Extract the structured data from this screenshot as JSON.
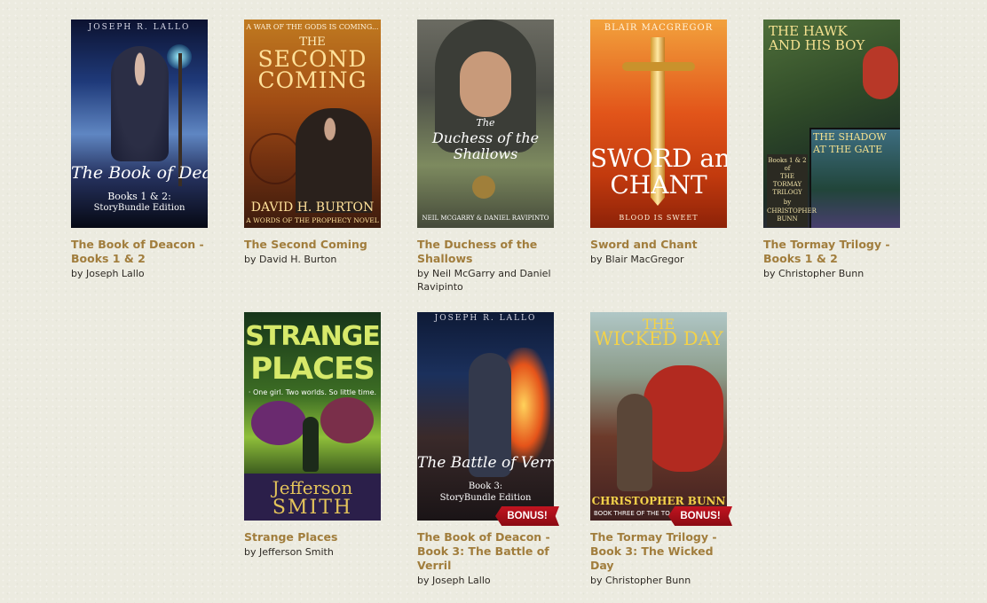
{
  "books": [
    {
      "title": "The Book of Deacon - Books 1 & 2",
      "author": "by Joseph Lallo",
      "cover": {
        "author": "JOSEPH R. LALLO",
        "title": "The Book of Deacon",
        "subtitle1": "Books 1 & 2:",
        "subtitle2": "StoryBundle Edition"
      }
    },
    {
      "title": "The Second Coming",
      "author": "by David H. Burton",
      "cover": {
        "tagline": "A WAR OF THE GODS IS COMING...",
        "title1": "THE",
        "title2": "SECOND",
        "title3": "COMING",
        "author": "DAVID H. BURTON",
        "subtitle": "A WORDS OF THE PROPHECY NOVEL"
      }
    },
    {
      "title": "The Duchess of the Shallows",
      "author": "by Neil McGarry and Daniel Ravipinto",
      "cover": {
        "title1": "The",
        "title2": "Duchess of the",
        "title3": "Shallows",
        "author": "NEIL MCGARRY & DANIEL RAVIPINTO"
      }
    },
    {
      "title": "Sword and Chant",
      "author": "by Blair MacGregor",
      "cover": {
        "author": "BLAIR MACGREGOR",
        "title1": "SWORD and",
        "title2": "CHANT",
        "tagline": "BLOOD IS SWEET"
      }
    },
    {
      "title": "The Tormay Trilogy - Books 1 & 2",
      "author": "by Christopher Bunn",
      "cover": {
        "title1": "THE HAWK",
        "title2": "AND HIS BOY",
        "title3": "THE SHADOW",
        "title4": "AT THE GATE",
        "box1": "Books 1 & 2",
        "box2": "of",
        "box3": "THE",
        "box4": "TORMAY",
        "box5": "TRILOGY",
        "box6": "by",
        "box7": "CHRISTOPHER",
        "box8": "BUNN"
      }
    },
    {
      "title": "Strange Places",
      "author": "by Jefferson Smith",
      "cover": {
        "title1": "STRANGE",
        "title2": "PLACES",
        "tagline": "· One girl.  Two worlds.  So little time.",
        "author1": "Jefferson",
        "author2": "SMITH"
      }
    },
    {
      "title": "The Book of Deacon - Book 3: The Battle of Verril",
      "author": "by Joseph Lallo",
      "badge": "BONUS!",
      "cover": {
        "author": "JOSEPH R. LALLO",
        "title": "The Battle of Verril",
        "subtitle1": "Book 3:",
        "subtitle2": "StoryBundle Edition"
      }
    },
    {
      "title": "The Tormay Trilogy - Book 3: The Wicked Day",
      "author": "by Christopher Bunn",
      "badge": "BONUS!",
      "cover": {
        "title1": "THE",
        "title2": "WICKED DAY",
        "author": "CHRISTOPHER BUNN",
        "subtitle": "BOOK THREE OF THE TO"
      }
    }
  ]
}
